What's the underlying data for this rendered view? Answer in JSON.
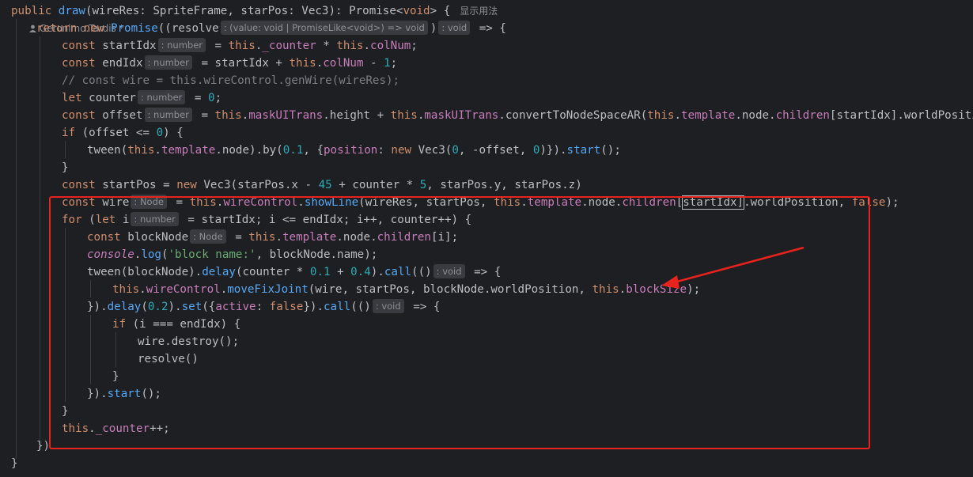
{
  "code": {
    "l1": {
      "kw_public": "public ",
      "fn_draw": "draw",
      "p1": "(wireRes: SpriteFrame, starPos: Vec3): Promise<",
      "kw_void": "void",
      "p2": "> {",
      "meta_usage": "显示用法",
      "meta_author": "Geronimo.Tardis *"
    },
    "l2": {
      "kw_return": "return ",
      "kw_new": "new ",
      "fn_promise": "Promise",
      "p1": "((resolve",
      "hint1": ": (value: void | PromiseLike<void>) => void",
      "p2": ")",
      "hint2": ": void",
      "p3": " => {"
    },
    "l3": {
      "kw": "const ",
      "name": "startIdx",
      "hint": ": number",
      "p1": " = ",
      "kw_this": "this",
      "p2": ".",
      "prop": "_counter",
      "p3": " * ",
      "kw_this2": "this",
      "p4": ".",
      "prop2": "colNum",
      "p5": ";"
    },
    "l4": {
      "kw": "const ",
      "name": "endIdx",
      "hint": ": number",
      "p1": " = startIdx + ",
      "kw_this": "this",
      "p2": ".",
      "prop": "colNum",
      "p3": " - ",
      "num": "1",
      "p4": ";"
    },
    "l5": {
      "comment": "// const wire = this.wireControl.genWire(wireRes);"
    },
    "l6": {
      "kw": "let ",
      "name": "counter",
      "hint": ": number",
      "p1": " = ",
      "num": "0",
      "p2": ";"
    },
    "l7": {
      "kw": "const ",
      "name": "offset",
      "hint": ": number",
      "p1": " = ",
      "kw_this": "this",
      "p2": ".",
      "prop": "maskUITrans",
      "p3": ".height + ",
      "kw_this2": "this",
      "p4": ".",
      "prop2": "maskUITrans",
      "p5": ".convertToNodeSpaceAR(",
      "kw_this3": "this",
      "p6": ".",
      "prop3": "template",
      "p7": ".node.",
      "prop4": "children",
      "p8": "[startIdx].worldPosition).y"
    },
    "l8": {
      "kw": "if ",
      "p1": "(offset <= ",
      "num": "0",
      "p2": ") {"
    },
    "l9": {
      "p1": "tween(",
      "kw_this": "this",
      "p2": ".",
      "prop": "template",
      "p3": ".node).by(",
      "num1": "0.1",
      "p4": ", {",
      "prop2": "position",
      "p5": ": ",
      "kw_new": "new ",
      "p6": "Vec3(",
      "num2": "0",
      "p7": ", -offset, ",
      "num3": "0",
      "p8": ")}).",
      "fn": "start",
      "p9": "();"
    },
    "l10": {
      "p1": "}"
    },
    "l11": {
      "kw": "const ",
      "p1": "startPos = ",
      "kw_new": "new ",
      "p2": "Vec3(starPos.x - ",
      "num1": "45",
      "p3": " + counter * ",
      "num2": "5",
      "p4": ", starPos.y, starPos.z)"
    },
    "l12": {
      "kw": "const ",
      "name": "wire",
      "hint": ": Node",
      "p1": " = ",
      "kw_this": "this",
      "p2": ".",
      "prop": "wireControl",
      "p3": ".",
      "fn": "showLine",
      "p4": "(wireRes, startPos, ",
      "kw_this2": "this",
      "p5": ".",
      "prop2": "template",
      "p6": ".node.",
      "prop3": "children",
      "p7": "[",
      "p_boxed": "startIdx]",
      "p8": ".worldPosition, ",
      "kw_false": "false",
      "p9": ");"
    },
    "l13": {
      "kw": "for ",
      "p1": "(",
      "kw_let": "let ",
      "name": "i",
      "hint": ": number",
      "p2": " = startIdx; i <= endIdx; i++, counter++) {"
    },
    "l14": {
      "kw": "const ",
      "name": "blockNode",
      "hint": ": Node",
      "p1": " = ",
      "kw_this": "this",
      "p2": ".",
      "prop": "template",
      "p3": ".node.",
      "prop2": "children",
      "p4": "[i];"
    },
    "l15": {
      "console": "console",
      "p1": ".",
      "fn": "log",
      "p2": "(",
      "str": "'block name:'",
      "p3": ", blockNode.name);"
    },
    "l16": {
      "p1": "tween(blockNode).",
      "fn": "delay",
      "p2": "(counter * ",
      "num1": "0.1",
      "p3": " + ",
      "num2": "0.4",
      "p4": ").",
      "fn2": "call",
      "p5": "(()",
      "hint": ": void",
      "p6": " => {"
    },
    "l17": {
      "kw_this": "this",
      "p1": ".",
      "prop": "wireControl",
      "p2": ".",
      "fn": "moveFixJoint",
      "p3": "(wire, startPos, blockNode.worldPosition, ",
      "kw_this2": "this",
      "p4": ".",
      "prop2": "blockSize",
      "p5": ");"
    },
    "l18": {
      "p1": "}).",
      "fn": "delay",
      "p2": "(",
      "num": "0.2",
      "p3": ").",
      "fn2": "set",
      "p4": "({",
      "prop": "active",
      "p5": ": ",
      "kw_false": "false",
      "p6": "}).",
      "fn3": "call",
      "p7": "(()",
      "hint": ": void",
      "p8": " => {"
    },
    "l19": {
      "kw": "if ",
      "p1": "(i === endIdx) {"
    },
    "l20": {
      "p1": "wire.destroy();"
    },
    "l21": {
      "p1": "resolve()"
    },
    "l22": {
      "p1": "}"
    },
    "l23": {
      "p1": "}).",
      "fn": "start",
      "p2": "();"
    },
    "l24": {
      "p1": "}"
    },
    "l25": {
      "kw_this": "this",
      "p1": ".",
      "prop": "_counter",
      "p2": "++;"
    },
    "l26": {
      "p1": "})"
    },
    "l27": {
      "p1": "}"
    }
  },
  "colors": {
    "background": "#1e1f22",
    "text": "#bcbec4",
    "keyword": "#cf8e6d",
    "function": "#56a8f5",
    "property": "#c77dbb",
    "number": "#2aacb8",
    "string": "#6aab73",
    "comment": "#7a7e85",
    "annotation": "#e8221c"
  },
  "icons": {
    "author": "person-icon"
  }
}
